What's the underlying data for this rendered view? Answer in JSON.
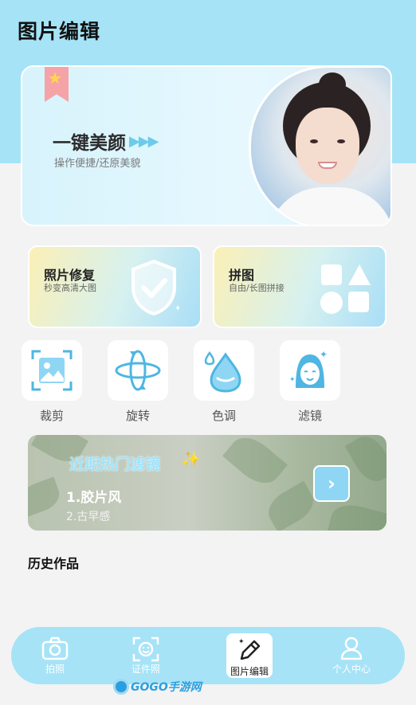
{
  "page": {
    "title": "图片编辑"
  },
  "hero": {
    "title": "一键美颜",
    "arrows": "▶▶▶",
    "subtitle": "操作便捷/还原美貌",
    "ribbon_icon": "star-icon"
  },
  "features": [
    {
      "title": "照片修复",
      "subtitle": "秒变高清大图",
      "icon": "shield-check-icon"
    },
    {
      "title": "拼图",
      "subtitle": "自由/长图拼接",
      "icon": "shapes-icon"
    }
  ],
  "tools": [
    {
      "label": "裁剪",
      "icon": "crop-image-icon"
    },
    {
      "label": "旋转",
      "icon": "rotate-icon"
    },
    {
      "label": "色调",
      "icon": "water-drop-icon"
    },
    {
      "label": "滤镜",
      "icon": "face-filter-icon"
    }
  ],
  "filter_banner": {
    "title": "近期热门滤镜",
    "items": [
      "1.胶片风",
      "2.古早感"
    ],
    "go_icon": "chevron-right-icon"
  },
  "history": {
    "title": "历史作品"
  },
  "nav": {
    "items": [
      {
        "label": "拍照",
        "icon": "camera-icon",
        "active": false
      },
      {
        "label": "证件照",
        "icon": "id-photo-icon",
        "active": false
      },
      {
        "label": "图片编辑",
        "icon": "pen-edit-icon",
        "active": true
      },
      {
        "label": "个人中心",
        "icon": "user-icon",
        "active": false
      }
    ]
  },
  "watermark": {
    "text": "GOGO手游网"
  },
  "colors": {
    "accent": "#a6e3f7",
    "background": "#f3f3f3",
    "filter_title": "#9fe3fb"
  }
}
